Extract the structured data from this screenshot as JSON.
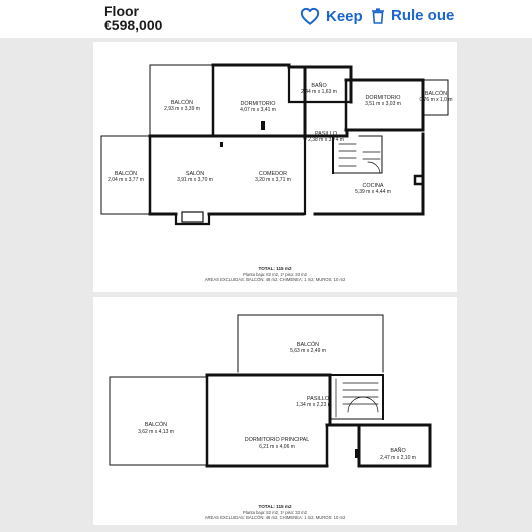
{
  "header": {
    "title": "Floor",
    "price": "€598,000",
    "keep_label": "Keep",
    "rule_label": "Rule oue",
    "accent_color": "#1a66cc"
  },
  "plan1": {
    "rooms": [
      {
        "name": "BALCÓN",
        "dims": "2,93 m x 3,39 m"
      },
      {
        "name": "DORMITORIO",
        "dims": "4,07 m x 3,41 m"
      },
      {
        "name": "BAÑO",
        "dims": "2,44 m x 1,63 m"
      },
      {
        "name": "DORMITORIO",
        "dims": "3,51 m x 3,03 m"
      },
      {
        "name": "BALCÓN",
        "dims": "0,76 m x 1,0 m"
      },
      {
        "name": "PASILLO",
        "dims": "2,38 m x 3,74 m"
      },
      {
        "name": "BALCÓN",
        "dims": "2,04 m x 3,77 m"
      },
      {
        "name": "SALÓN",
        "dims": "3,91 m x 3,70 m"
      },
      {
        "name": "COMEDOR",
        "dims": "3,20 m x 3,71 m"
      },
      {
        "name": "COCINA",
        "dims": "5,39 m x 4,44 m"
      }
    ],
    "total": "TOTAL: 115 m2",
    "subtotal": "Planta baja: 82 m2, 1º piso: 33 m2",
    "excluded": "AREAS EXCLUIDAS: BALCÓN: 48 m2, CHIMENEA: 1 m2, MUROS: 10 m2"
  },
  "plan2": {
    "rooms": [
      {
        "name": "BALCÓN",
        "dims": "5,63 m x 2,49 m"
      },
      {
        "name": "PASILLO",
        "dims": "1,34 m x 2,23 m"
      },
      {
        "name": "BALCÓN",
        "dims": "3,62 m x 4,13 m"
      },
      {
        "name": "DORMITORIO PRINCIPAL",
        "dims": "6,21 m x 4,06 m"
      },
      {
        "name": "BAÑO",
        "dims": "2,47 m x 2,10 m"
      }
    ],
    "total": "TOTAL: 115 m2",
    "subtotal": "Planta baja: 82 m2, 1º piso: 33 m2",
    "excluded": "AREAS EXCLUIDAS: BALCÓN: 48 m2, CHIMENEA: 1 m2, MUROS: 10 m2"
  }
}
